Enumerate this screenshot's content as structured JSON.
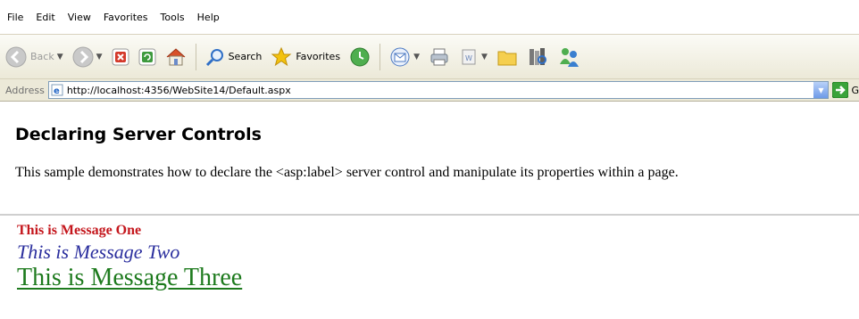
{
  "menu": [
    "File",
    "Edit",
    "View",
    "Favorites",
    "Tools",
    "Help"
  ],
  "toolbar": {
    "back_label": "Back",
    "search_label": "Search",
    "favorites_label": "Favorites"
  },
  "address": {
    "label": "Address",
    "url": "http://localhost:4356/WebSite14/Default.aspx",
    "go_label": "G"
  },
  "page": {
    "title": "Declaring Server Controls",
    "description": "This sample demonstrates how to declare the <asp:label> server control and manipulate its properties within a page.",
    "messages": [
      {
        "text": "This is Message One",
        "color": "#c4161c"
      },
      {
        "text": "This is Message Two",
        "color": "#2b2f9e"
      },
      {
        "text": "This is Message Three",
        "color": "#1d7a1d"
      }
    ]
  },
  "icons": [
    "back-arrow-icon",
    "forward-arrow-icon",
    "stop-icon",
    "refresh-icon",
    "home-icon",
    "search-icon",
    "favorites-star-icon",
    "history-icon",
    "mail-icon",
    "print-icon",
    "edit-icon",
    "folder-icon",
    "research-icon",
    "messenger-icon",
    "ie-page-icon",
    "go-arrow-icon"
  ]
}
